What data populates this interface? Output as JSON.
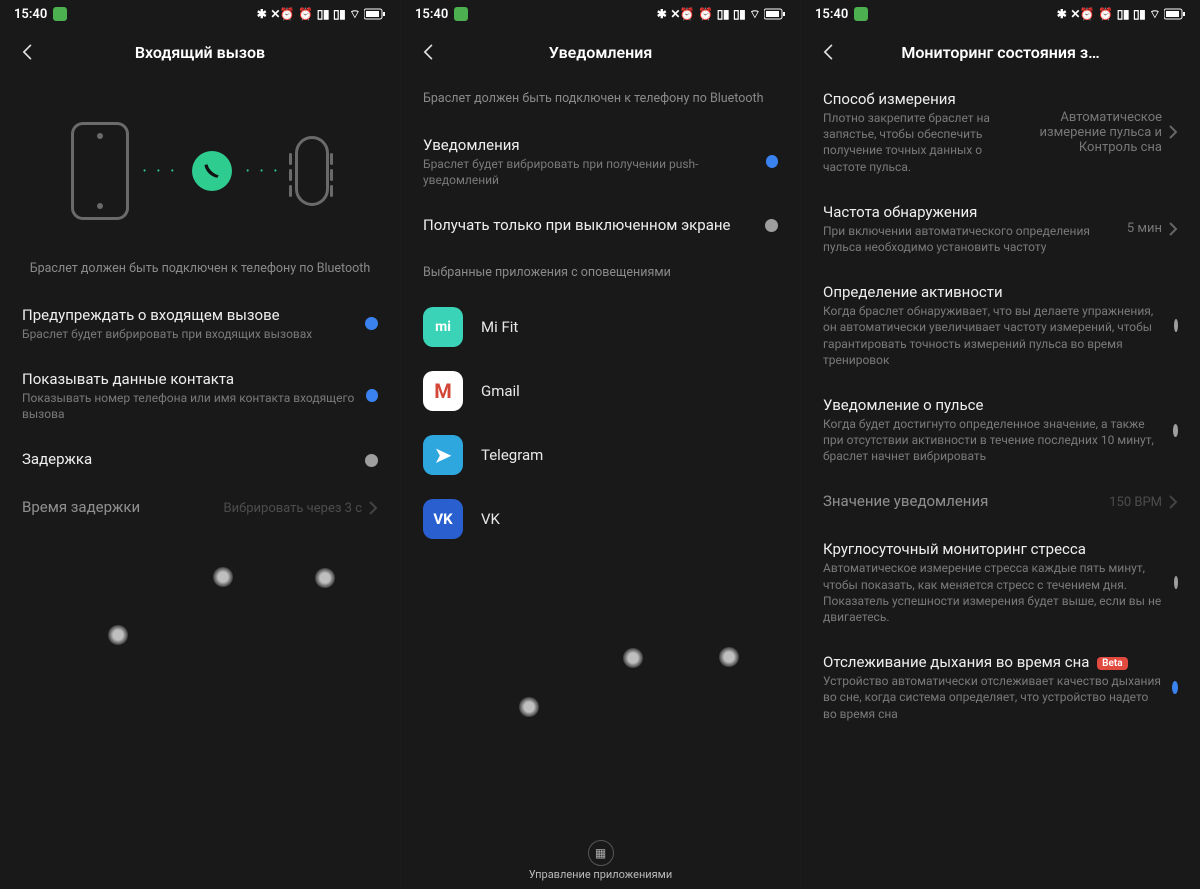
{
  "status": {
    "time": "15:40",
    "icons": "✱ ✈ ⏰ 📶 📶 📶 🔋"
  },
  "screens": [
    {
      "title": "Входящий вызов",
      "notice": "Браслет должен быть подключен к телефону по Bluetooth",
      "rows": [
        {
          "title": "Предупреждать о входящем вызове",
          "sub": "Браслет будет вибрировать при входящих вызовах",
          "toggle": "on"
        },
        {
          "title": "Показывать данные контакта",
          "sub": "Показывать номер телефона или имя контакта входящего вызова",
          "toggle": "on"
        },
        {
          "title": "Задержка",
          "sub": "",
          "toggle": "off"
        },
        {
          "title": "Время задержки",
          "sub": "",
          "value": "Вибрировать через 3 с",
          "chevron": true,
          "dim": true
        }
      ]
    },
    {
      "title": "Уведомления",
      "notice": "Браслет должен быть подключен к телефону по Bluetooth",
      "rows": [
        {
          "title": "Уведомления",
          "sub": "Браслет будет вибрировать при получении push-уведомлений",
          "toggle": "on"
        },
        {
          "title": "Получать только при выключенном экране",
          "sub": "",
          "toggle": "off"
        }
      ],
      "section": "Выбранные приложения с оповещениями",
      "apps": [
        {
          "name": "Mi Fit",
          "bg": "#3bd3b8",
          "glyph": "mi"
        },
        {
          "name": "Gmail",
          "bg": "#ffffff",
          "glyph": "M",
          "fg": "#d44638"
        },
        {
          "name": "Telegram",
          "bg": "#2ea6de",
          "glyph": "➤"
        },
        {
          "name": "VK",
          "bg": "#2a5fd0",
          "glyph": "VK"
        }
      ],
      "manage": "Управление приложениями"
    },
    {
      "title": "Мониторинг состояния з…",
      "rows": [
        {
          "title": "Способ измерения",
          "sub": "Плотно закрепите браслет на запястье, чтобы обеспечить получение точных данных о частоте пульса.",
          "value": "Автоматическое измерение пульса и Контроль сна",
          "chevron": true
        },
        {
          "title": "Частота обнаружения",
          "sub": "При включении автоматического определения пульса необходимо установить частоту",
          "value": "5 мин",
          "chevron": true
        },
        {
          "title": "Определение активности",
          "sub": "Когда браслет обнаруживает, что вы делаете упражнения, он автоматически увеличивает частоту измерений, чтобы гарантировать точность измерений пульса во время тренировок",
          "toggle": "off"
        },
        {
          "title": "Уведомление о пульсе",
          "sub": "Когда будет достигнуто определенное значение, а также при отсутствии активности в течение последних 10 минут, браслет начнет вибрировать",
          "toggle": "off"
        },
        {
          "title": "Значение уведомления",
          "sub": "",
          "value": "150 BPM",
          "chevron": true,
          "dim": true
        },
        {
          "title": "Круглосуточный мониторинг стресса",
          "sub": "Автоматическое измерение стресса каждые пять минут, чтобы показать, как меняется стресс с течением дня. Показатель успешности измерения будет выше, если вы не двигаетесь.",
          "toggle": "off"
        },
        {
          "title": "Отслеживание дыхания во время сна",
          "badge": "Beta",
          "sub": "Устройство автоматически отслеживает качество дыхания во сне, когда система определяет, что устройство надето во время сна",
          "toggle": "on"
        }
      ]
    }
  ]
}
